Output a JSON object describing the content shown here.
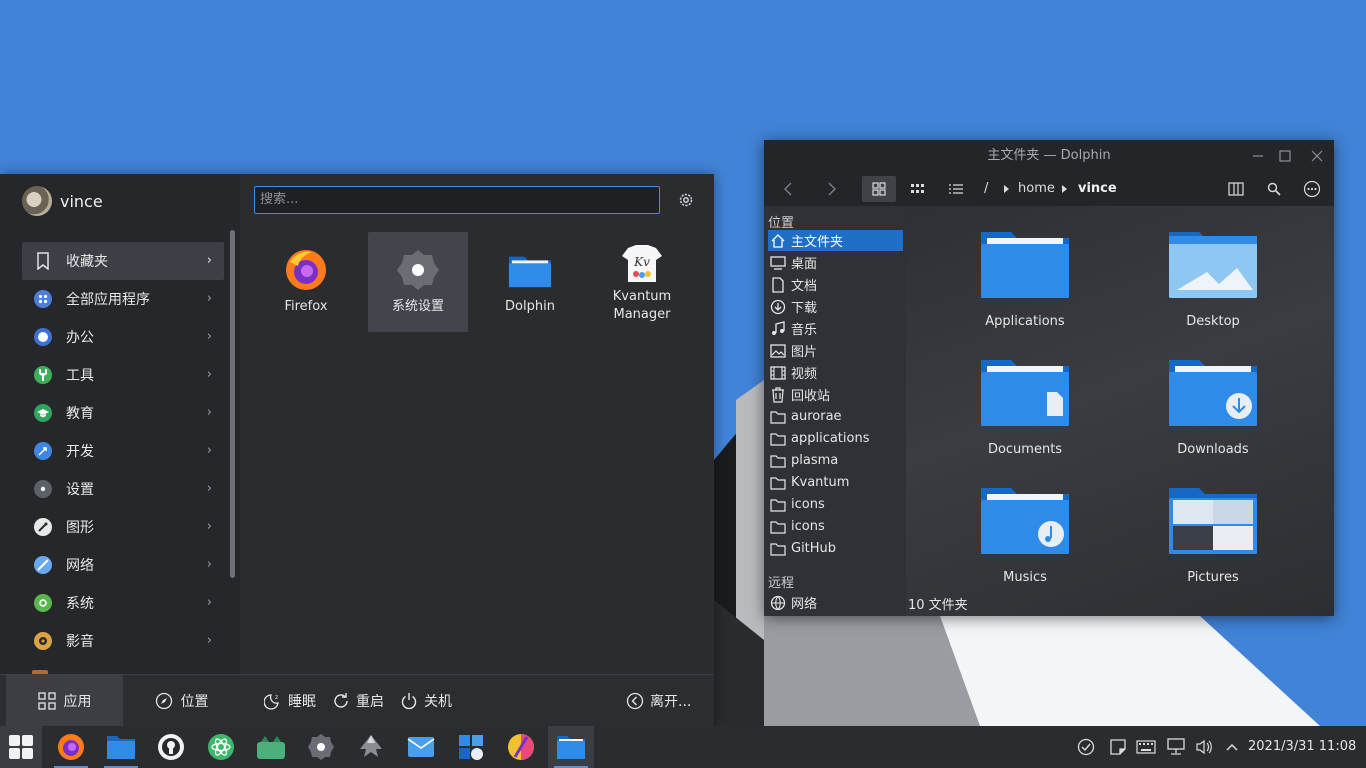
{
  "launcher": {
    "user_name": "vince",
    "search_placeholder": "搜索...",
    "categories": [
      {
        "label": "收藏夹",
        "icon": "bookmark-icon",
        "color": "#cfd2d6"
      },
      {
        "label": "全部应用程序",
        "icon": "grid-apps-icon",
        "color": "#4a7fdc"
      },
      {
        "label": "办公",
        "icon": "office-icon",
        "color": "#3f6fd8"
      },
      {
        "label": "工具",
        "icon": "tools-icon",
        "color": "#3cae5c"
      },
      {
        "label": "教育",
        "icon": "education-icon",
        "color": "#2fa35f"
      },
      {
        "label": "开发",
        "icon": "development-icon",
        "color": "#3f86e0"
      },
      {
        "label": "设置",
        "icon": "settings-icon",
        "color": "#5c6067"
      },
      {
        "label": "图形",
        "icon": "graphics-icon",
        "color": "#e8e8e8"
      },
      {
        "label": "网络",
        "icon": "internet-icon",
        "color": "#6aa8ef"
      },
      {
        "label": "系统",
        "icon": "system-icon",
        "color": "#58b84a"
      },
      {
        "label": "影音",
        "icon": "multimedia-icon",
        "color": "#d9a441"
      }
    ],
    "favorites": [
      {
        "label": "Firefox",
        "icon": "firefox-icon"
      },
      {
        "label": "系统设置",
        "icon": "system-settings-icon"
      },
      {
        "label": "Dolphin",
        "icon": "dolphin-folder-icon"
      },
      {
        "label": "Kvantum\nManager",
        "icon": "kvantum-icon"
      }
    ],
    "bottom": {
      "tab_apps": "应用",
      "tab_places": "位置",
      "sleep": "睡眠",
      "restart": "重启",
      "shutdown": "关机",
      "leave": "离开..."
    }
  },
  "dolphin": {
    "title": "主文件夹 — Dolphin",
    "breadcrumb": [
      "/",
      "home",
      "vince"
    ],
    "places_title": "位置",
    "places": [
      {
        "label": "主文件夹",
        "icon": "home-icon"
      },
      {
        "label": "桌面",
        "icon": "desktop-icon"
      },
      {
        "label": "文档",
        "icon": "documents-icon"
      },
      {
        "label": "下载",
        "icon": "download-icon"
      },
      {
        "label": "音乐",
        "icon": "music-icon"
      },
      {
        "label": "图片",
        "icon": "pictures-icon"
      },
      {
        "label": "视频",
        "icon": "videos-icon"
      },
      {
        "label": "回收站",
        "icon": "trash-icon"
      },
      {
        "label": "aurorae",
        "icon": "folder-icon"
      },
      {
        "label": "applications",
        "icon": "folder-icon"
      },
      {
        "label": "plasma",
        "icon": "folder-icon"
      },
      {
        "label": "Kvantum",
        "icon": "folder-icon"
      },
      {
        "label": "icons",
        "icon": "folder-icon"
      },
      {
        "label": "icons",
        "icon": "folder-icon"
      },
      {
        "label": "GitHub",
        "icon": "folder-icon"
      }
    ],
    "remote_title": "远程",
    "remote": [
      {
        "label": "网络",
        "icon": "network-icon"
      }
    ],
    "folders": [
      {
        "label": "Applications",
        "icon": "folder-icon"
      },
      {
        "label": "Desktop",
        "icon": "desktop-folder-icon"
      },
      {
        "label": "Documents",
        "icon": "documents-folder-icon"
      },
      {
        "label": "Downloads",
        "icon": "downloads-folder-icon"
      },
      {
        "label": "Musics",
        "icon": "music-folder-icon"
      },
      {
        "label": "Pictures",
        "icon": "pictures-folder-icon"
      }
    ],
    "status": "10 文件夹"
  },
  "taskbar": {
    "apps": [
      {
        "name": "firefox-icon"
      },
      {
        "name": "files-icon"
      },
      {
        "name": "github-icon"
      },
      {
        "name": "atom-icon"
      },
      {
        "name": "kvantum-taskbar-icon"
      },
      {
        "name": "system-settings-icon"
      },
      {
        "name": "inkscape-icon"
      },
      {
        "name": "mail-icon"
      },
      {
        "name": "discover-icon"
      },
      {
        "name": "color-picker-icon"
      },
      {
        "name": "dolphin-icon"
      }
    ],
    "clock": "2021/3/31 11:08"
  }
}
